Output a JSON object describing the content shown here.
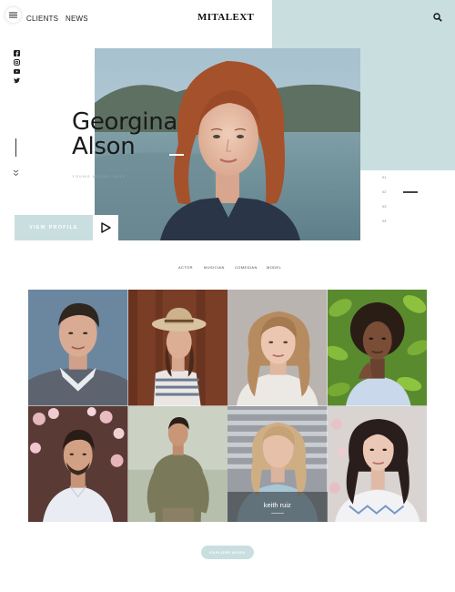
{
  "header": {
    "menu_icon": "hamburger-icon",
    "nav": [
      {
        "label": "CLIENTS"
      },
      {
        "label": "NEWS"
      }
    ],
    "logo": "MITALEXT",
    "search_icon": "search-icon"
  },
  "social": [
    "facebook-icon",
    "instagram-icon",
    "youtube-icon",
    "twitter-icon"
  ],
  "hero": {
    "first_name": "Georgina",
    "last_name": "Alson",
    "role": "YOUNG MODEL 2020",
    "cta_label": "VIEW PROFILE",
    "play_icon": "play-icon",
    "slides": [
      "01",
      "02",
      "03",
      "04"
    ],
    "active_slide": "02"
  },
  "filters": [
    "ACTOR",
    "MUSICIAN",
    "COMEDIAN",
    "MODEL"
  ],
  "gallery": {
    "tiles": [
      {
        "caption": ""
      },
      {
        "caption": ""
      },
      {
        "caption": ""
      },
      {
        "caption": ""
      },
      {
        "caption": ""
      },
      {
        "caption": ""
      },
      {
        "caption": "keith ruiz"
      },
      {
        "caption": ""
      }
    ]
  },
  "explore_label": "EXPLORE MORE",
  "colors": {
    "accent": "#c9dedf",
    "text": "#222222",
    "background": "#ffffff"
  }
}
